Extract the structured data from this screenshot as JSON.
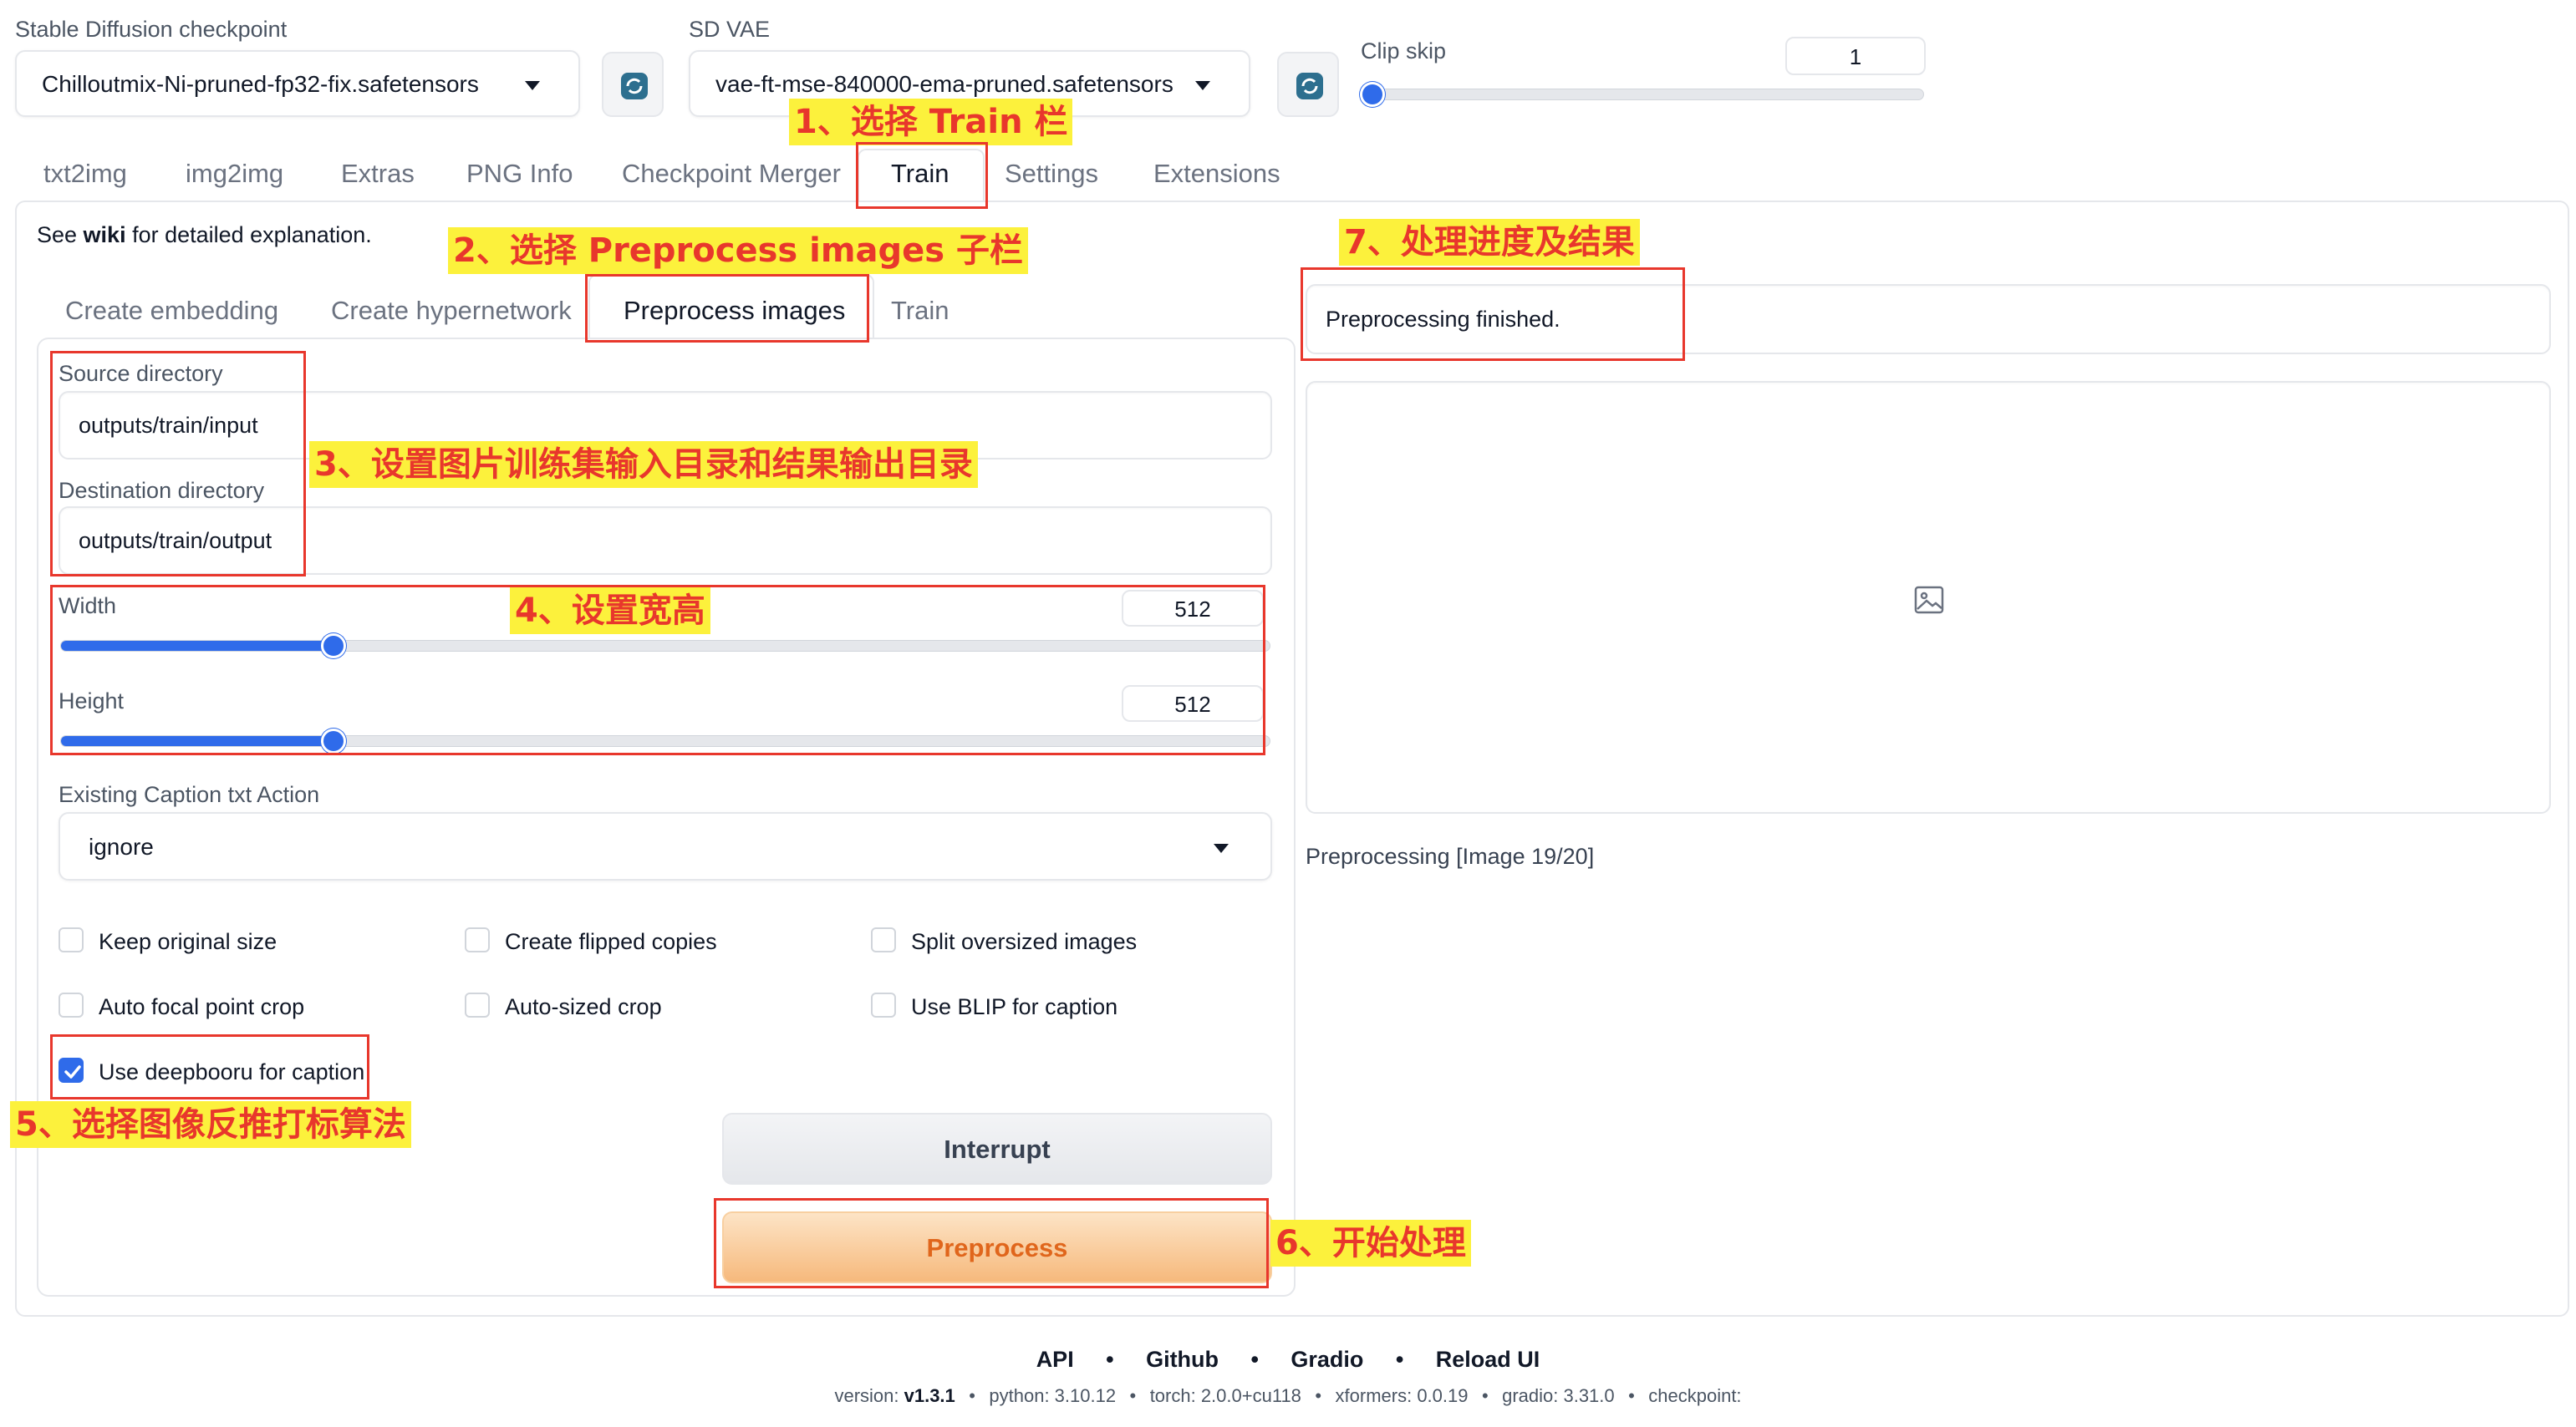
{
  "top": {
    "checkpoint_label": "Stable Diffusion checkpoint",
    "checkpoint_value": "Chilloutmix-Ni-pruned-fp32-fix.safetensors",
    "vae_label": "SD VAE",
    "vae_value": "vae-ft-mse-840000-ema-pruned.safetensors",
    "clip_skip_label": "Clip skip",
    "clip_skip_value": "1"
  },
  "tabs": [
    "txt2img",
    "img2img",
    "Extras",
    "PNG Info",
    "Checkpoint Merger",
    "Train",
    "Settings",
    "Extensions"
  ],
  "train": {
    "wiki_prefix": "See ",
    "wiki_link": "wiki",
    "wiki_suffix": " for detailed explanation.",
    "subtabs": [
      "Create embedding",
      "Create hypernetwork",
      "Preprocess images",
      "Train"
    ],
    "source_label": "Source directory",
    "source_value": "outputs/train/input",
    "dest_label": "Destination directory",
    "dest_value": "outputs/train/output",
    "width_label": "Width",
    "width_value": "512",
    "height_label": "Height",
    "height_value": "512",
    "caption_action_label": "Existing Caption txt Action",
    "caption_action_value": "ignore",
    "checkboxes": [
      {
        "label": "Keep original size",
        "checked": false
      },
      {
        "label": "Create flipped copies",
        "checked": false
      },
      {
        "label": "Split oversized images",
        "checked": false
      },
      {
        "label": "Auto focal point crop",
        "checked": false
      },
      {
        "label": "Auto-sized crop",
        "checked": false
      },
      {
        "label": "Use BLIP for caption",
        "checked": false
      },
      {
        "label": "Use deepbooru for caption",
        "checked": true
      }
    ],
    "interrupt_label": "Interrupt",
    "preprocess_label": "Preprocess",
    "status_text": "Preprocessing finished.",
    "progress_text": "Preprocessing [Image 19/20]"
  },
  "annotations": {
    "a1": "1、选择 Train 栏",
    "a2": "2、选择 Preprocess images 子栏",
    "a3": "3、设置图片训练集输入目录和结果输出目录",
    "a4": "4、设置宽高",
    "a5": "5、选择图像反推打标算法",
    "a6": "6、开始处理",
    "a7": "7、处理进度及结果"
  },
  "footer": {
    "links": [
      "API",
      "Github",
      "Gradio",
      "Reload UI"
    ],
    "sep": "•",
    "version_label": "version: ",
    "version_value": "v1.3.1",
    "python": "python: 3.10.12",
    "torch": "torch: 2.0.0+cu118",
    "xformers": "xformers: 0.0.19",
    "gradio": "gradio: 3.31.0",
    "checkpoint": "checkpoint:"
  },
  "sliders": {
    "width_fraction": 0.226,
    "height_fraction": 0.226
  },
  "colors": {
    "accent": "#2f6bea",
    "annotation_red": "#e8372c",
    "annotation_yellow": "#fcf13c",
    "preprocess_orange": "#e0661c"
  }
}
